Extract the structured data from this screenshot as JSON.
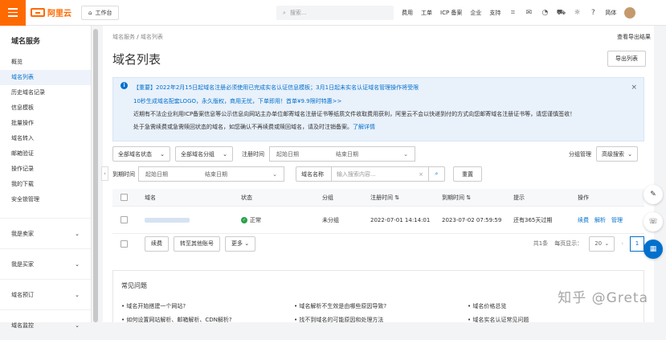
{
  "topbar": {
    "brand": "阿里云",
    "workbench": "工作台",
    "search_placeholder": "搜索...",
    "nav": [
      "费用",
      "工单",
      "ICP 备案",
      "企业",
      "支持"
    ],
    "lang": "简体"
  },
  "sidebar": {
    "title": "域名服务",
    "items": [
      "概览",
      "域名列表",
      "历史域名记录",
      "信息模板",
      "批量操作",
      "域名转入",
      "邮箱验证",
      "操作记录",
      "我的下载",
      "安全锁管理"
    ],
    "active_index": 1,
    "groups": [
      "我是卖家",
      "我是买家",
      "域名预订",
      "域名监控"
    ]
  },
  "main": {
    "breadcrumb": [
      "域名服务",
      "域名列表"
    ],
    "export_record": "查看导出结果",
    "title": "域名列表",
    "export_btn": "导出列表"
  },
  "notice": {
    "line1": "【重要】2022年2月15日起域名注册必须使用已完成实名认证信息模板；3月1日起未实名认证域名管理操作将受限",
    "line2": "10秒生成域名配套LOGO，永久版权，商用无忧，下单即用！首单¥9.9限时特惠>>",
    "line3": "近期有不法企业利用ICP备案信息等公示信息向网站主办单位邮寄域名注册证书等纸质文件收取费用获利，阿里云不会以快递到付的方式向您邮寄域名注册证书等，请您谨慎签收！",
    "line4": "处于急需续费或急需赎回状态的域名，如您确认不再续费或赎回域名，请及时注销备案。",
    "line4_link": "了解详情"
  },
  "filters": {
    "status": "全部域名状态",
    "group": "全部域名分组",
    "reg_time_label": "注册时间",
    "start": "起始日期",
    "end": "结束日期",
    "group_manage": "分组管理",
    "advanced": "高级搜索",
    "expire_label": "到期时间",
    "search_field": "域名名称",
    "search_placeholder": "输入搜索内容...",
    "reset": "重置"
  },
  "table": {
    "headers": [
      "域名",
      "状态",
      "分组",
      "注册时间",
      "到期时间",
      "提示",
      "操作"
    ],
    "rows": [
      {
        "status": "正常",
        "group": "未分组",
        "reg_time": "2022-07-01 14:14:01",
        "expire_time": "2023-07-02 07:59:59",
        "tip": "还有365天过期",
        "actions": [
          "续费",
          "解析",
          "管理"
        ]
      }
    ]
  },
  "bulk": {
    "renew": "续费",
    "transfer": "转至其他账号",
    "more": "更多",
    "total": "共1条",
    "per_page_label": "每页显示：",
    "per_page": "20",
    "page": "1"
  },
  "faq": {
    "title": "常见问题",
    "items": [
      "域名开始搭建一个网站?",
      "域名解析不生效是由哪些原因导致?",
      "域名价格总览",
      "如何设置网站解析、邮箱解析、CDN解析?",
      "找不到域名的可能原因和处理方法",
      "域名实名认证常见问题"
    ]
  },
  "watermark": "知乎 @Greta"
}
